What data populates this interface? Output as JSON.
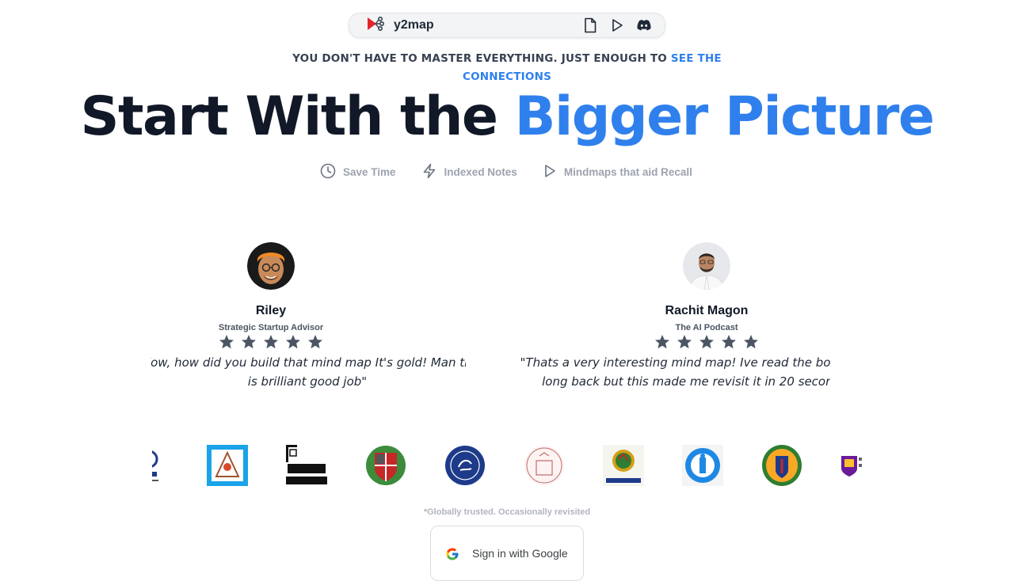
{
  "topbar": {
    "app_name": "y2map",
    "icons": [
      "document-icon",
      "play-icon",
      "discord-icon"
    ]
  },
  "tagline": {
    "text": "YOU DON'T HAVE TO MASTER EVERYTHING. JUST ENOUGH TO ",
    "highlight": "SEE THE CONNECTIONS"
  },
  "headline": {
    "text": "Start With the ",
    "highlight": "Bigger Picture"
  },
  "features": [
    {
      "icon": "clock-icon",
      "label": "Save Time"
    },
    {
      "icon": "lightning-icon",
      "label": "Indexed Notes"
    },
    {
      "icon": "play-icon",
      "label": "Mindmaps that aid Recall"
    }
  ],
  "testimonials": [
    {
      "name": "Riley",
      "role": "Strategic Startup Advisor",
      "stars": 5,
      "quote": "\"Wow, how did you build that mind map It's gold! Man this is brilliant good job\""
    },
    {
      "name": "Rachit Magon",
      "role": "The AI Podcast",
      "stars": 5,
      "quote": "\"Thats a very interesting mind map! Ive read the book long long back but this made me revisit it in 20 seconds\""
    }
  ],
  "trusted_note": "*Globally trusted. Occasionally revisited",
  "signin": {
    "label": "Sign in with Google"
  },
  "colors": {
    "accent": "#2f80ed",
    "brand_red": "#e3262c",
    "star": "#4b5563"
  }
}
